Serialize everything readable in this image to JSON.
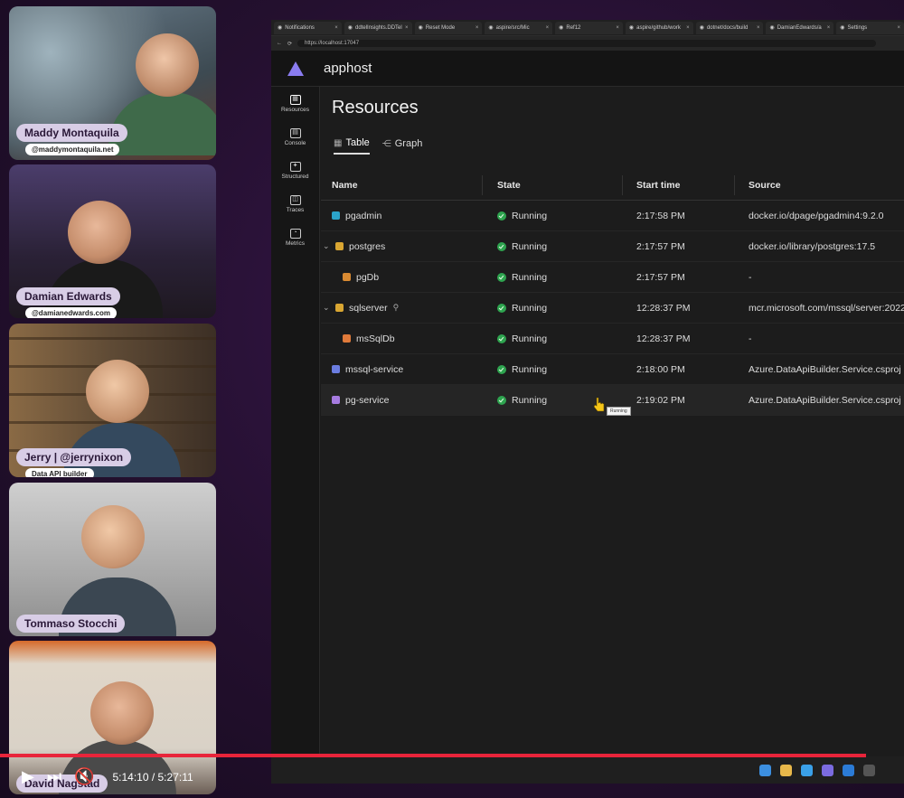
{
  "participants": [
    {
      "name": "Maddy Montaquila",
      "handle": "@maddymontaquila.net"
    },
    {
      "name": "Damian Edwards",
      "handle": "@damianedwards.com"
    },
    {
      "name": "Jerry | @jerrynixon",
      "handle": "Data API builder"
    },
    {
      "name": "Tommaso Stocchi",
      "handle": ""
    },
    {
      "name": "David Nagstad",
      "handle": ""
    }
  ],
  "browser": {
    "tabs": [
      "Notifications",
      "ddtelInsights.DDTel",
      "Reset Mode",
      "aspire/src/Mic",
      "Ref12",
      "aspire/github/work",
      "dotnet/docs/build",
      "DamianEdwards/a",
      "Settings"
    ],
    "url": "https://localhost:17047"
  },
  "app": {
    "title": "apphost",
    "nav": [
      {
        "label": "Resources",
        "icon": "resources-icon"
      },
      {
        "label": "Console",
        "icon": "console-icon"
      },
      {
        "label": "Structured",
        "icon": "structured-icon"
      },
      {
        "label": "Traces",
        "icon": "traces-icon"
      },
      {
        "label": "Metrics",
        "icon": "metrics-icon"
      }
    ],
    "page_title": "Resources",
    "view_tabs": [
      "Table",
      "Graph"
    ],
    "columns": [
      "Name",
      "State",
      "Start time",
      "Source"
    ],
    "rows": [
      {
        "name": "pgadmin",
        "state": "Running",
        "start": "2:17:58 PM",
        "source": "docker.io/dpage/pgadmin4:9.2.0",
        "color": "#2ba3c9",
        "expand": ""
      },
      {
        "name": "postgres",
        "state": "Running",
        "start": "2:17:57 PM",
        "source": "docker.io/library/postgres:17.5",
        "color": "#d9a632",
        "expand": "⌄"
      },
      {
        "name": "pgDb",
        "state": "Running",
        "start": "2:17:57 PM",
        "source": "-",
        "color": "#d98a32",
        "expand": ""
      },
      {
        "name": "sqlserver",
        "state": "Running",
        "start": "12:28:37 PM",
        "source": "mcr.microsoft.com/mssql/server:2022",
        "color": "#d9a632",
        "expand": "⌄"
      },
      {
        "name": "msSqlDb",
        "state": "Running",
        "start": "12:28:37 PM",
        "source": "-",
        "color": "#e07a3a",
        "expand": ""
      },
      {
        "name": "mssql-service",
        "state": "Running",
        "start": "2:18:00 PM",
        "source": "Azure.DataApiBuilder.Service.csproj",
        "color": "#6b7de0",
        "expand": ""
      },
      {
        "name": "pg-service",
        "state": "Running",
        "start": "2:19:02 PM",
        "source": "Azure.DataApiBuilder.Service.csproj",
        "color": "#a67be0",
        "expand": ""
      }
    ],
    "tooltip": "Running"
  },
  "player": {
    "time": "5:14:10 / 5:27:11",
    "progress_fraction": 0.958
  }
}
